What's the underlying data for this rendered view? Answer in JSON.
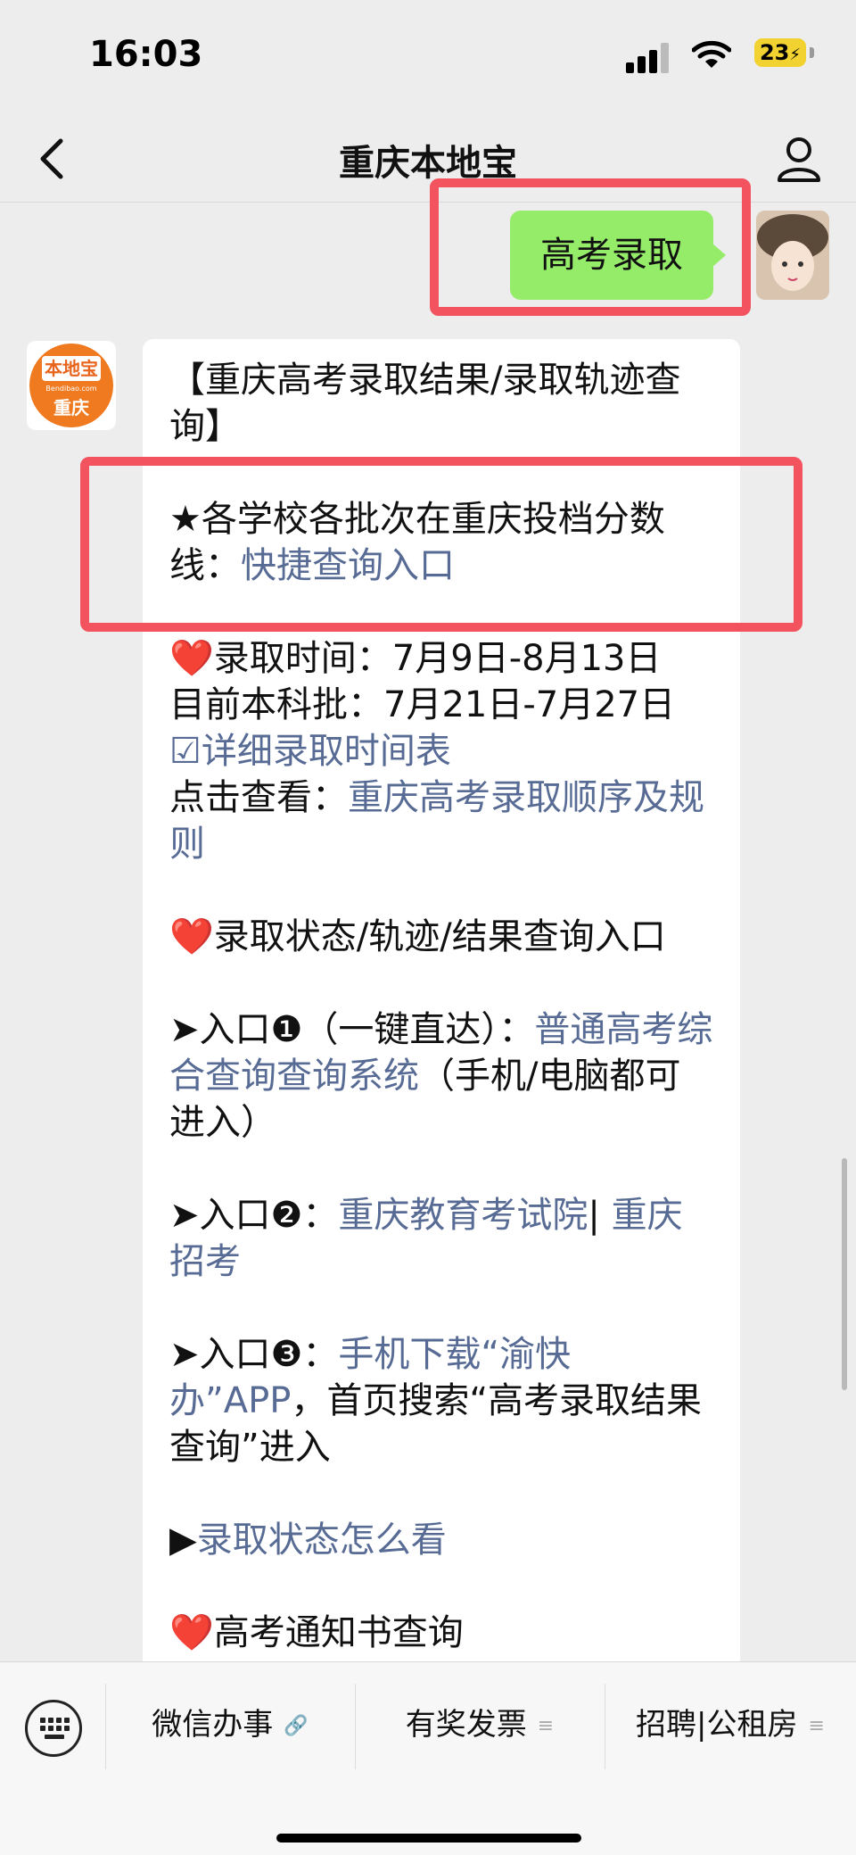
{
  "status_bar": {
    "time": "16:03",
    "battery_level": "23"
  },
  "nav": {
    "title": "重庆本地宝"
  },
  "my_message": {
    "text": "高考录取"
  },
  "bot_avatar": {
    "logo_brand": "本地宝",
    "logo_url": "Bendibao.com",
    "logo_city": "重庆"
  },
  "reply": {
    "heading": "【重庆高考录取结果/录取轨迹查询】",
    "score_line_prefix": "★各学校各批次在重庆投档分数线：",
    "score_line_link": "快捷查询入口",
    "admission_time": "❤️录取时间：7月9日-8月13日",
    "current_batch": "目前本科批：7月21日-7月27日",
    "schedule_link": "☑详细录取时间表",
    "click_view_prefix": "点击查看：",
    "order_rules_link": "重庆高考录取顺序及规则",
    "status_query_heading": "❤️录取状态/轨迹/结果查询入口",
    "entry1_prefix": "➤入口❶（一键直达）：",
    "entry1_link": "普通高考综合查询查询系统",
    "entry1_suffix": "（手机/电脑都可进入）",
    "entry2_prefix": "➤入口❷：",
    "entry2_link_a": "重庆教育考试院",
    "entry2_separator": "| ",
    "entry2_link_b": "重庆招考",
    "entry3_prefix": "➤入口❸：",
    "entry3_link": "手机下载“渝快办”APP",
    "entry3_suffix": "，首页搜索“高考录取结果查询”进入",
    "status_guide_marker": "▶",
    "status_guide_link": "录取状态怎么看",
    "notice_heading": "❤️高考通知书查询"
  },
  "bottom_menu": {
    "items": [
      {
        "label": "微信办事",
        "icon": "link-icon"
      },
      {
        "label": "有奖发票",
        "icon": "menu-lines-icon"
      },
      {
        "label": "招聘|公租房",
        "icon": "menu-lines-icon"
      }
    ]
  },
  "colors": {
    "my_bubble": "#95ec69",
    "link": "#576b95",
    "highlight_border": "#f2535e",
    "background": "#ededed"
  }
}
